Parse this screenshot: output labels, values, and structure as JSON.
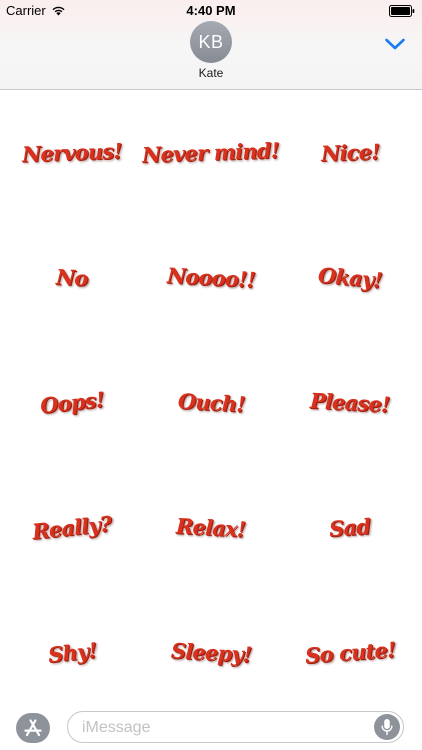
{
  "status_bar": {
    "carrier": "Carrier",
    "time": "4:40 PM"
  },
  "header": {
    "avatar_initials": "KB",
    "contact_name": "Kate",
    "collapse_icon": "chevron-down-icon",
    "accent_color": "#1a7cf4"
  },
  "stickers": [
    {
      "label": "Nervous!"
    },
    {
      "label": "Never mind!"
    },
    {
      "label": "Nice!"
    },
    {
      "label": "No"
    },
    {
      "label": "Noooo!!"
    },
    {
      "label": "Okay!"
    },
    {
      "label": "Oops!"
    },
    {
      "label": "Ouch!"
    },
    {
      "label": "Please!"
    },
    {
      "label": "Really?"
    },
    {
      "label": "Relax!"
    },
    {
      "label": "Sad"
    },
    {
      "label": "Shy!"
    },
    {
      "label": "Sleepy!"
    },
    {
      "label": "So cute!"
    }
  ],
  "input_bar": {
    "placeholder": "iMessage",
    "app_store_icon": "app-store-icon",
    "mic_icon": "microphone-icon"
  },
  "colors": {
    "sticker_text": "#d8321e",
    "button_gray": "#8e929b"
  }
}
